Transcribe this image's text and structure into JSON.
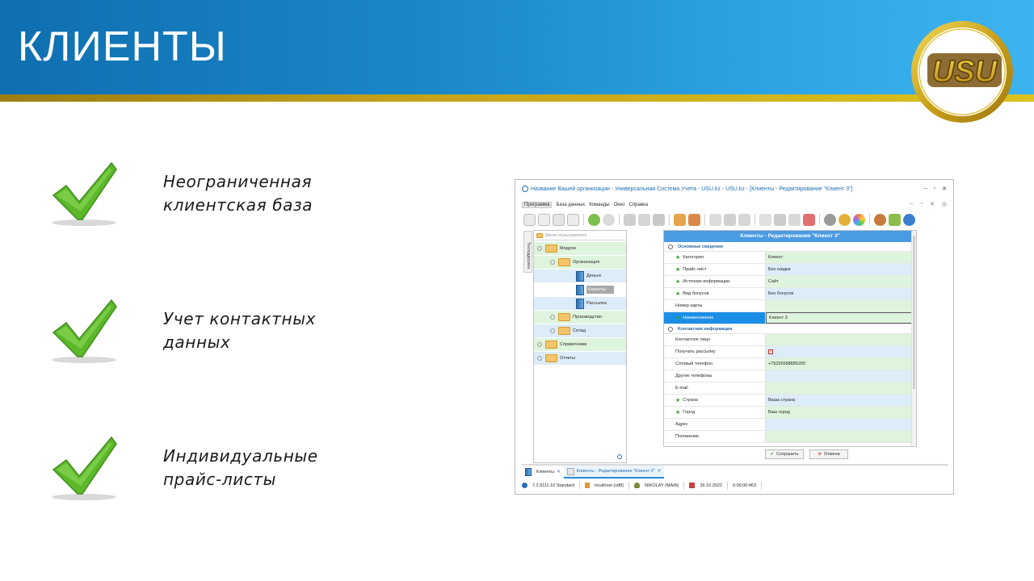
{
  "slide": {
    "title": "КЛИЕНТЫ",
    "logo_text": "USU",
    "features": [
      {
        "line1": "Неограниченная",
        "line2": "клиентская база"
      },
      {
        "line1": "Учет контактных",
        "line2": "данных"
      },
      {
        "line1": "Индивидуальные",
        "line2": "прайс-листы"
      }
    ],
    "colors": {
      "banner": "#1a86c8",
      "gold": "#c6a21b",
      "check": "#5cb82a"
    }
  },
  "app": {
    "window_title": "Название Вашей организации - Универсальная Система Учета - USU.kz - USU.kz - [Клиенты - Редактирование \"Клиент 3\"]",
    "window_controls": [
      "–",
      "▫",
      "✕"
    ],
    "menu": [
      "Программа",
      "База данных",
      "Команды",
      "Окно",
      "Справка"
    ],
    "menu_controls": [
      "–",
      "▫",
      "✕",
      "◎"
    ],
    "side_tab": "Техподдержка",
    "tree": {
      "header": "Меню пользователя",
      "items": [
        {
          "label": "Модули"
        },
        {
          "label": "Организация"
        },
        {
          "label": "Деньги"
        },
        {
          "label": "Клиенты"
        },
        {
          "label": "Рассылка"
        },
        {
          "label": "Производство"
        },
        {
          "label": "Склад"
        },
        {
          "label": "Справочники"
        },
        {
          "label": "Отчеты"
        }
      ]
    },
    "form": {
      "title": "Клиенты - Редактирование \"Клиент 3\"",
      "section1": "Основные сведения",
      "rows1": [
        {
          "label": "Категория",
          "value": "Клиент"
        },
        {
          "label": "Прайс-лист",
          "value": "Без скидки"
        },
        {
          "label": "Источник информации",
          "value": "Сайт"
        },
        {
          "label": "Вид бонусов",
          "value": "Без бонусов"
        },
        {
          "label": "Номер карты",
          "value": ""
        },
        {
          "label": "Наименование",
          "value": "Клиент 3"
        }
      ],
      "section2": "Контактная информация",
      "rows2": [
        {
          "label": "Контактное лицо",
          "value": ""
        },
        {
          "label": "Получать рассылку",
          "value": ""
        },
        {
          "label": "Сотовый телефон",
          "value": "+79256588885200"
        },
        {
          "label": "Другие телефоны",
          "value": ""
        },
        {
          "label": "E-mail",
          "value": ""
        },
        {
          "label": "Страна",
          "value": "Ваша страна"
        },
        {
          "label": "Город",
          "value": "Ваш город"
        },
        {
          "label": "Адрес",
          "value": ""
        },
        {
          "label": "Положение",
          "value": ""
        }
      ],
      "save_label": "Сохранить",
      "cancel_label": "Отмена"
    },
    "tabs": [
      {
        "label": "Клиенты"
      },
      {
        "label": "Клиенты - Редактирование \"Клиент 3\""
      }
    ],
    "status": {
      "version": "7.2.9111.10 Standard",
      "db": "localhost (utf8)",
      "user": "NIKOLAY (MAIN)",
      "date": "26.10.2022",
      "timer": "0:00:00:463"
    }
  }
}
